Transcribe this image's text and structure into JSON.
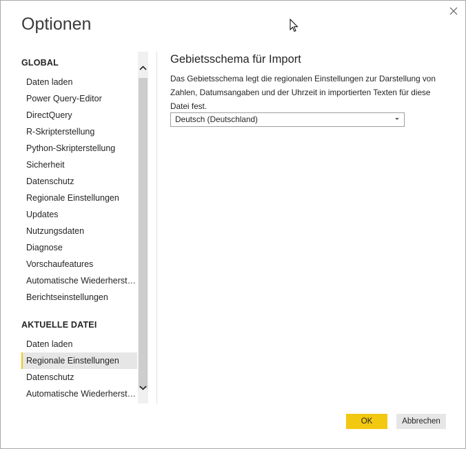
{
  "window": {
    "title": "Optionen"
  },
  "sidebar": {
    "global_heading": "GLOBAL",
    "global_items": [
      {
        "label": "Daten laden"
      },
      {
        "label": "Power Query-Editor"
      },
      {
        "label": "DirectQuery"
      },
      {
        "label": "R-Skripterstellung"
      },
      {
        "label": "Python-Skripterstellung"
      },
      {
        "label": "Sicherheit"
      },
      {
        "label": "Datenschutz"
      },
      {
        "label": "Regionale Einstellungen"
      },
      {
        "label": "Updates"
      },
      {
        "label": "Nutzungsdaten"
      },
      {
        "label": "Diagnose"
      },
      {
        "label": "Vorschaufeatures"
      },
      {
        "label": "Automatische Wiederherstellung"
      },
      {
        "label": "Berichtseinstellungen"
      }
    ],
    "current_heading": "AKTUELLE DATEI",
    "current_items": [
      {
        "label": "Daten laden"
      },
      {
        "label": "Regionale Einstellungen",
        "selected": true
      },
      {
        "label": "Datenschutz"
      },
      {
        "label": "Automatische Wiederherstellung"
      }
    ]
  },
  "content": {
    "heading": "Gebietsschema für Import",
    "description": "Das Gebietsschema legt die regionalen Einstellungen zur Darstellung von Zahlen, Datumsangaben und der Uhrzeit in importierten Texten für diese Datei fest.",
    "locale_select": {
      "selected": "Deutsch (Deutschland)"
    }
  },
  "footer": {
    "ok_label": "OK",
    "cancel_label": "Abbrechen"
  },
  "colors": {
    "accent": "#f2c811",
    "selected_bg": "#e6e6e6"
  },
  "icons": {
    "close": "close-icon",
    "scroll_up": "chevron-up-icon",
    "scroll_down": "chevron-down-icon",
    "cursor": "mouse-pointer-icon",
    "dropdown": "caret-down-icon"
  }
}
